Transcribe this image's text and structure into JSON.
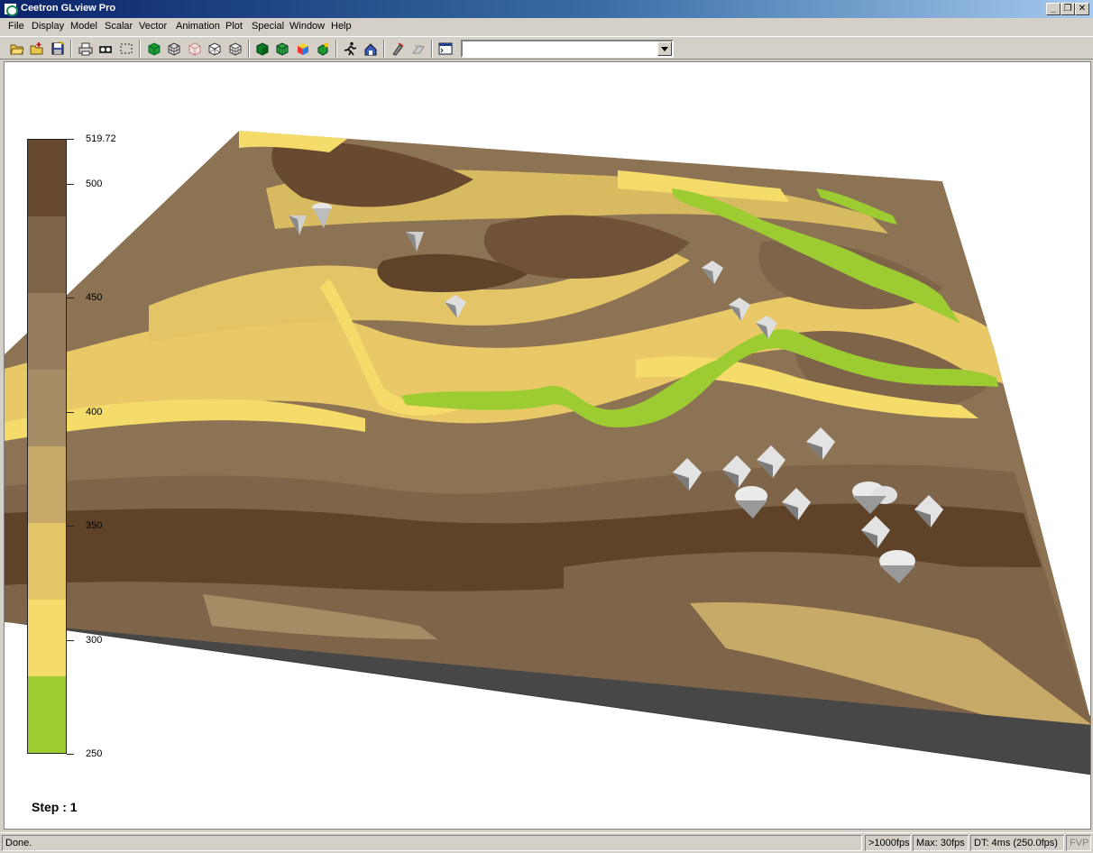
{
  "window": {
    "title": "Ceetron GLview Pro",
    "controls": {
      "minimize": "_",
      "restore": "❐",
      "close": "✕"
    }
  },
  "menu": [
    "File",
    "Display",
    "Model",
    "Scalar",
    "Vector",
    "Animation",
    "Plot",
    "Special",
    "Window",
    "Help"
  ],
  "toolbar": {
    "buttons": [
      "open-file-icon",
      "open-add-icon",
      "save-icon",
      "print-icon",
      "camera-icon",
      "select-region-icon",
      "solid-cube-icon",
      "wire-cube-icon",
      "point-cube-icon",
      "outline-cube-icon",
      "mesh-cube-icon",
      "shaded-cube-icon",
      "green-mesh-cube-icon",
      "color-cube-icon",
      "small-cube-icon",
      "run-animation-icon",
      "fly-to-icon",
      "camera-settings-icon",
      "clip-icon",
      "console-icon"
    ],
    "combo_value": ""
  },
  "legend": {
    "max_label": "519.72",
    "labels": [
      "500",
      "450",
      "400",
      "350",
      "300",
      "250"
    ],
    "label_values": [
      500,
      450,
      400,
      350,
      300,
      250
    ],
    "min": 250,
    "max": 519.72,
    "colors": [
      "#9ccc32",
      "#f5dc6a",
      "#e3c567",
      "#c8aa68",
      "#a48c65",
      "#987c5e",
      "#7e6448",
      "#674a2f"
    ]
  },
  "step": {
    "label": "Step : 1"
  },
  "status": {
    "message": "Done.",
    "fps": ">1000fps",
    "max": "Max: 30fps",
    "dt": "DT: 4ms (250.0fps)",
    "fvp": "FVP"
  }
}
